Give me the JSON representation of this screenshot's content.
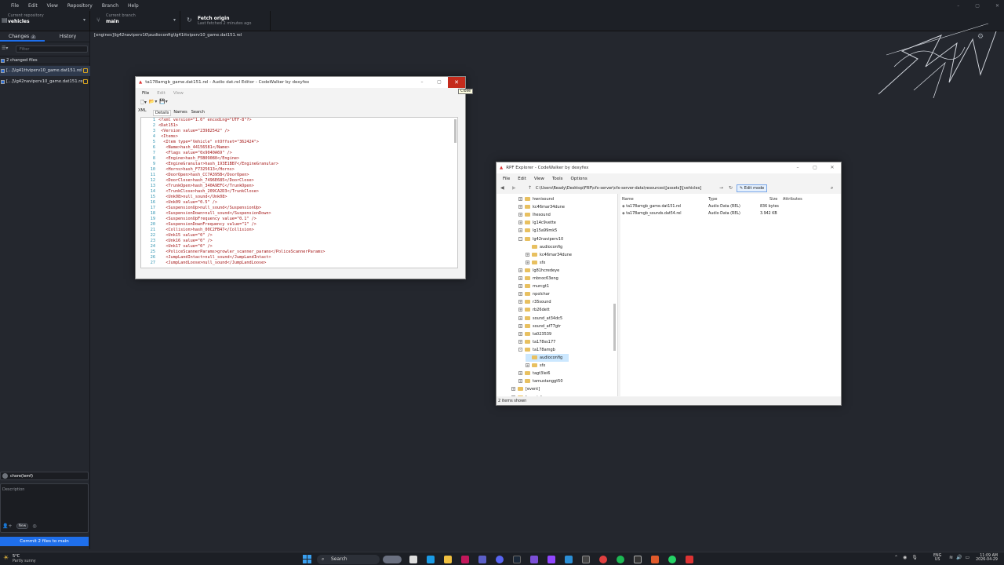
{
  "menubar": {
    "items": [
      "File",
      "Edit",
      "View",
      "Repository",
      "Branch",
      "Help"
    ]
  },
  "toolbar": {
    "repo_small": "Current repository",
    "repo_name": "vehicles",
    "branch_small": "Current branch",
    "branch_name": "main",
    "fetch_title": "Fetch origin",
    "fetch_sub": "Last fetched 2 minutes ago"
  },
  "sidebar": {
    "tab_changes": "Changes",
    "changes_count": "2",
    "tab_history": "History",
    "filter_placeholder": "Filter",
    "changed_files": "2 changed files",
    "files": [
      "[...]\\lg41ttviperv10_game.dat151.rel",
      "[...]\\lg42naviperv10_game.dat151.rel"
    ],
    "commit_summary": "chore(lemf)",
    "commit_desc_placeholder": "Description",
    "new_badge": "New",
    "commit_button": "Commit 2 files to main"
  },
  "pathbar": "[engines]\\lg42naviperv10\\audioconfig\\lg41ttviperv10_game.dat151.rel",
  "editor": {
    "title": "ta178amgb_game.dat151.rel - Audio dat.rel Editor - CodeWalker by dexyfex",
    "menu": [
      "File",
      "Edit",
      "View"
    ],
    "side_tab": "XML",
    "tabs": [
      "Details",
      "Names",
      "Search"
    ],
    "tooltip": "Close",
    "lines": [
      {
        "n": "1",
        "t": "<?xml version=\"1.0\" encoding=\"UTF-8\"?>"
      },
      {
        "n": "2",
        "t": "<Dat151>"
      },
      {
        "n": "3",
        "t": " <Version value=\"23982542\" />"
      },
      {
        "n": "4",
        "t": " <Items>"
      },
      {
        "n": "5",
        "t": "  <Item type=\"Vehicle\" ntOffset=\"362424\">"
      },
      {
        "n": "6",
        "t": "   <Name>hash_44156581</Name>"
      },
      {
        "n": "7",
        "t": "   <Flags value=\"0x9040A69\" />"
      },
      {
        "n": "8",
        "t": "   <Engine>hash_F5B09080</Engine>"
      },
      {
        "n": "9",
        "t": "   <EngineGranular>hash_193E1BB7</EngineGranular>"
      },
      {
        "n": "10",
        "t": "   <Horns>hash_F7325613</Horns>"
      },
      {
        "n": "11",
        "t": "   <DoorOpen>hash_CC7A395B</DoorOpen>"
      },
      {
        "n": "12",
        "t": "   <DoorClose>hash_7496E685</DoorClose>"
      },
      {
        "n": "13",
        "t": "   <TrunkOpen>hash_340A9EFC</TrunkOpen>"
      },
      {
        "n": "14",
        "t": "   <TrunkClose>hash_209CA2D3</TrunkClose>"
      },
      {
        "n": "15",
        "t": "   <Unk08>null_sound</Unk08>"
      },
      {
        "n": "16",
        "t": "   <Unk09 value=\"0.5\" />"
      },
      {
        "n": "17",
        "t": "   <SuspensionUp>null_sound</SuspensionUp>"
      },
      {
        "n": "18",
        "t": "   <SuspensionDown>null_sound</SuspensionDown>"
      },
      {
        "n": "19",
        "t": "   <SuspensionUpFrequency value=\"0.1\" />"
      },
      {
        "n": "20",
        "t": "   <SuspensionDownFrequency value=\"1\" />"
      },
      {
        "n": "21",
        "t": "   <Collision>hash_00C2FB47</Collision>"
      },
      {
        "n": "22",
        "t": "   <Unk15 value=\"0\" />"
      },
      {
        "n": "23",
        "t": "   <Unk16 value=\"0\" />"
      },
      {
        "n": "24",
        "t": "   <Unk17 value=\"0\" />"
      },
      {
        "n": "25",
        "t": "   <PoliceScannerParams>growler_scanner_params</PoliceScannerParams>"
      },
      {
        "n": "26",
        "t": "   <JumpLandIntact>null_sound</JumpLandIntact>"
      },
      {
        "n": "27",
        "t": "   <JumpLandLoose>null_sound</JumpLandLoose>"
      }
    ]
  },
  "rpf": {
    "title": "RPF Explorer - CodeWalker by dexyfex",
    "menu": [
      "File",
      "Edit",
      "View",
      "Tools",
      "Options"
    ],
    "address": "C:\\Users\\Ready\\Desktop\\FRP\\cfx-server\\cfx-server-data\\resources\\[assets]\\[vehicles]",
    "edit_mode": "Edit mode",
    "tree": [
      {
        "label": "hwnisound",
        "depth": 2,
        "exp": "+"
      },
      {
        "label": "kc46mar34dune",
        "depth": 2,
        "exp": "+"
      },
      {
        "label": "lhesound",
        "depth": 2,
        "exp": "+"
      },
      {
        "label": "lg14c9vette",
        "depth": 2,
        "exp": "+"
      },
      {
        "label": "lg15a99mk5",
        "depth": 2,
        "exp": "+"
      },
      {
        "label": "lg42naviperv10",
        "depth": 2,
        "exp": "-"
      },
      {
        "label": "audioconfig",
        "depth": 3,
        "exp": ""
      },
      {
        "label": "kc46mar34dune",
        "depth": 3,
        "exp": "+"
      },
      {
        "label": "sfx",
        "depth": 3,
        "exp": "+"
      },
      {
        "label": "lg81hcredeye",
        "depth": 2,
        "exp": "+"
      },
      {
        "label": "mbnoc63eng",
        "depth": 2,
        "exp": "+"
      },
      {
        "label": "murcgt1",
        "depth": 2,
        "exp": "+"
      },
      {
        "label": "npolchar",
        "depth": 2,
        "exp": "+"
      },
      {
        "label": "r35sound",
        "depth": 2,
        "exp": "+"
      },
      {
        "label": "rb26dett",
        "depth": 2,
        "exp": "+"
      },
      {
        "label": "sound_at34dc5",
        "depth": 2,
        "exp": "+"
      },
      {
        "label": "sound_af77gtr",
        "depth": 2,
        "exp": "+"
      },
      {
        "label": "ta023539",
        "depth": 2,
        "exp": "+"
      },
      {
        "label": "ta178ss177",
        "depth": 2,
        "exp": "+"
      },
      {
        "label": "ta178amgb",
        "depth": 2,
        "exp": "-"
      },
      {
        "label": "audioconfig",
        "depth": 3,
        "exp": "",
        "selected": true
      },
      {
        "label": "sfx",
        "depth": 3,
        "exp": "+"
      },
      {
        "label": "tagt3lei6",
        "depth": 2,
        "exp": "+"
      },
      {
        "label": "tamustanggt50",
        "depth": 2,
        "exp": "+"
      },
      {
        "label": "[event]",
        "depth": 1,
        "exp": "+"
      },
      {
        "label": "[events]",
        "depth": 1,
        "exp": "+"
      }
    ],
    "columns": [
      "Name",
      "Type",
      "Size",
      "Attributes"
    ],
    "files": [
      {
        "name": "ta178amgb_game.dat151.rel",
        "type": "Audio Data (REL)",
        "size": "836 bytes"
      },
      {
        "name": "ta178amgb_sounds.dat54.rel",
        "type": "Audio Data (REL)",
        "size": "3.942 KB"
      }
    ],
    "status": "2 items shown"
  },
  "taskbar": {
    "weather_temp": "5°C",
    "weather_desc": "Partly sunny",
    "search": "Search",
    "lang_top": "ENG",
    "lang_bottom": "US",
    "time": "11:09 AM",
    "date": "2026-04-29"
  },
  "colors": {
    "accent": "#1f6feb",
    "close_red": "#c42b1c",
    "bg": "#24272e",
    "badge": "#d6a31f"
  }
}
